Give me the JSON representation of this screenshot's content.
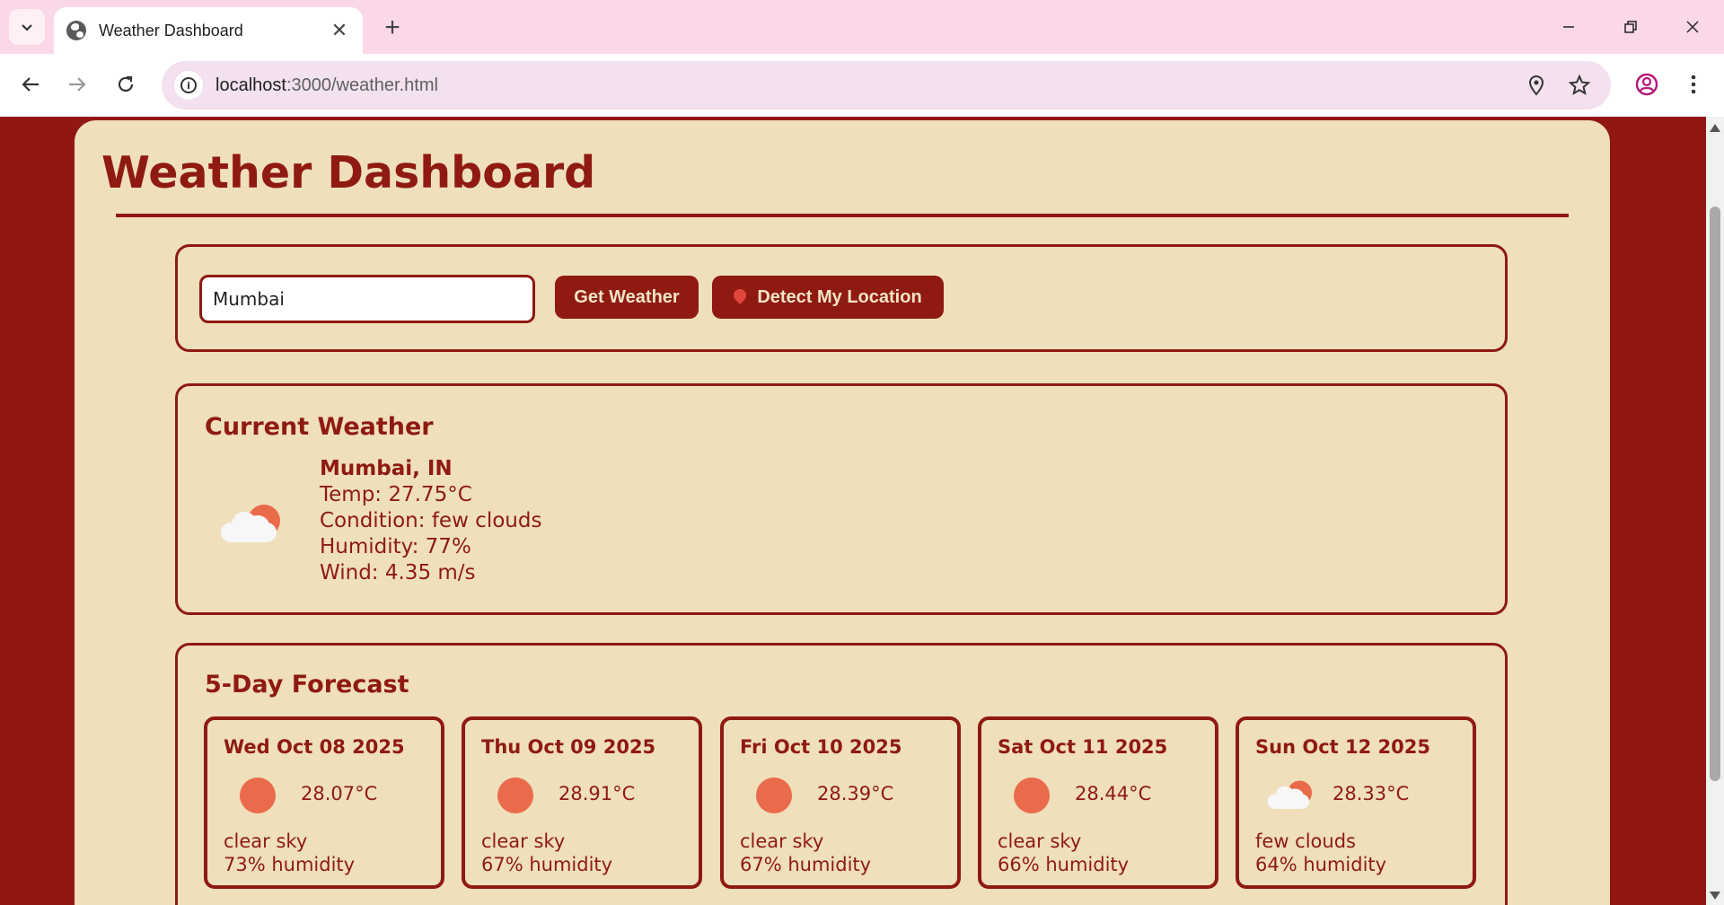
{
  "browser": {
    "tab_title": "Weather Dashboard",
    "url_host": "localhost",
    "url_rest": ":3000/weather.html"
  },
  "page": {
    "title": "Weather Dashboard"
  },
  "search": {
    "city_value": "Mumbai",
    "get_weather_label": "Get Weather",
    "detect_location_label": "Detect My Location"
  },
  "current": {
    "heading": "Current Weather",
    "icon": "cloud-sun-icon",
    "city": "Mumbai, IN",
    "temp": "Temp: 27.75°C",
    "condition": "Condition: few clouds",
    "humidity": "Humidity: 77%",
    "wind": "Wind: 4.35 m/s"
  },
  "forecast": {
    "heading": "5-Day Forecast",
    "days": [
      {
        "date": "Wed Oct 08 2025",
        "icon": "sun-icon",
        "temp": "28.07°C",
        "desc": "clear sky",
        "humidity": "73% humidity"
      },
      {
        "date": "Thu Oct 09 2025",
        "icon": "sun-icon",
        "temp": "28.91°C",
        "desc": "clear sky",
        "humidity": "67% humidity"
      },
      {
        "date": "Fri Oct 10 2025",
        "icon": "sun-icon",
        "temp": "28.39°C",
        "desc": "clear sky",
        "humidity": "67% humidity"
      },
      {
        "date": "Sat Oct 11 2025",
        "icon": "sun-icon",
        "temp": "28.44°C",
        "desc": "clear sky",
        "humidity": "66% humidity"
      },
      {
        "date": "Sun Oct 12 2025",
        "icon": "cloud-sun-icon",
        "temp": "28.33°C",
        "desc": "few clouds",
        "humidity": "64% humidity"
      }
    ]
  },
  "colors": {
    "page_background": "#911712",
    "card_background": "#efdfbb",
    "accent": "#8f1a12",
    "sun": "#ea6b4c"
  }
}
